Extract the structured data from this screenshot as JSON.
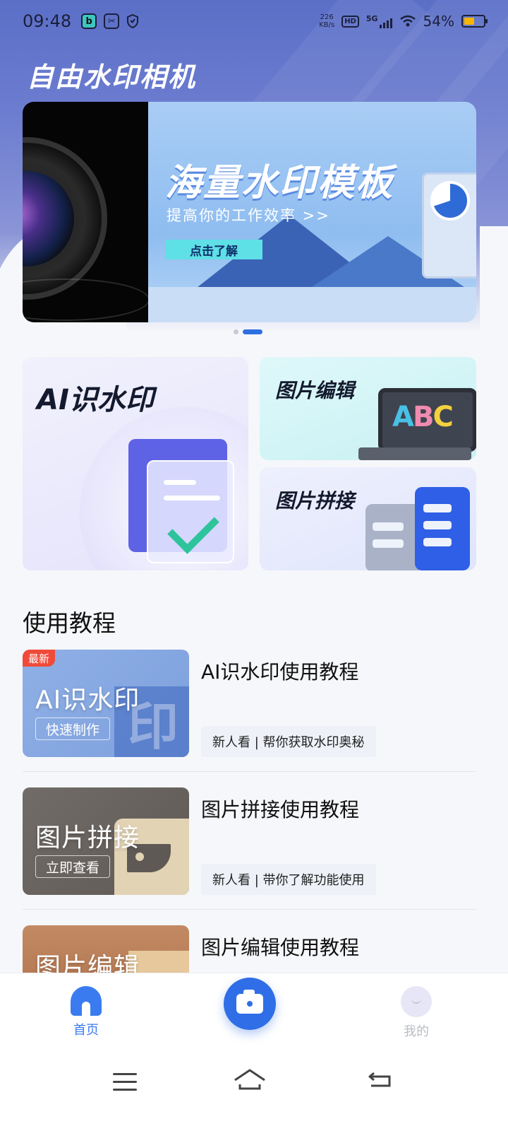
{
  "status_bar": {
    "time": "09:48",
    "speed_value": "226",
    "speed_unit": "KB/s",
    "hd": "HD",
    "network": "5G",
    "battery": "54%"
  },
  "app": {
    "title": "自由水印相机"
  },
  "banner": {
    "headline": "海量水印模板",
    "subtitle": "提高你的工作效率 >>",
    "cta": "点击了解",
    "active_index": 1,
    "count": 2
  },
  "features": {
    "ai": {
      "title": "AI识水印"
    },
    "edit": {
      "title": "图片编辑",
      "art_text": "ABC"
    },
    "stitch": {
      "title": "图片拼接"
    }
  },
  "tutorials": {
    "section_title": "使用教程",
    "items": [
      {
        "thumb_title": "AI识水印",
        "thumb_button": "快速制作",
        "thumb_tag": "最新",
        "thumb_deco": "印",
        "title": "AI识水印使用教程",
        "desc": "新人看 | 帮你获取水印奥秘"
      },
      {
        "thumb_title": "图片拼接",
        "thumb_button": "立即查看",
        "title": "图片拼接使用教程",
        "desc": "新人看 | 带你了解功能使用"
      },
      {
        "thumb_title": "图片编辑",
        "title": "图片编辑使用教程"
      }
    ]
  },
  "bottom_nav": {
    "home_label": "首页",
    "mine_label": "我的",
    "active": "home",
    "accent": "#3a7cf0"
  },
  "icons": [
    "home-icon",
    "camera-icon",
    "profile-icon",
    "menu-icon",
    "system-home-icon",
    "back-icon"
  ]
}
